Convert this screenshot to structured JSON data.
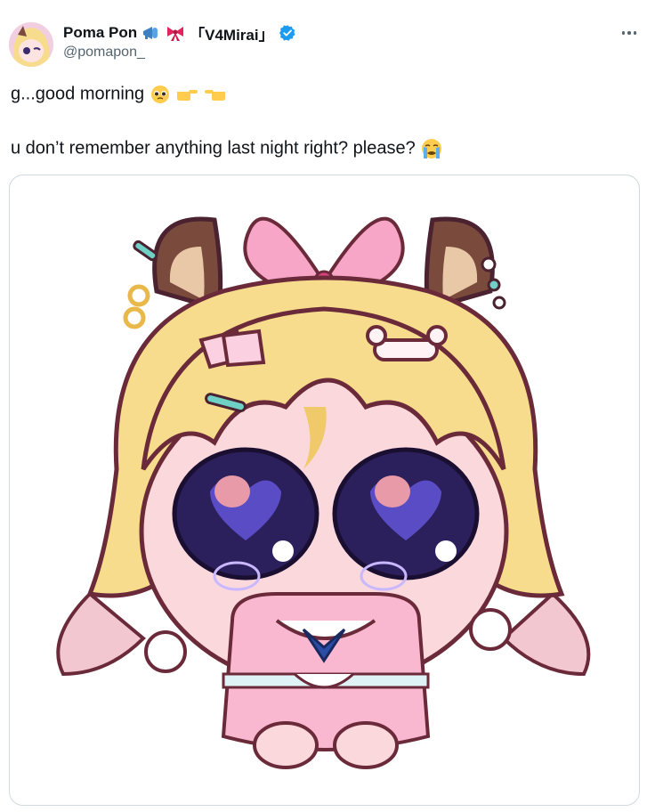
{
  "author": {
    "display_name": "Poma Pon",
    "display_name_suffix": "「V4Mirai」",
    "handle": "@pomapon_",
    "verified": true,
    "avatar_icon": "avatar-icon",
    "name_emojis": [
      "megaphone-icon",
      "ribbon-icon"
    ]
  },
  "menu": {
    "icon": "more-icon"
  },
  "tweet": {
    "line1": "g...good morning",
    "line1_emojis": [
      "pleading-face-icon",
      "point-right-icon",
      "point-left-icon"
    ],
    "line2": "u don’t remember anything last night right? please?",
    "line2_emojis": [
      "crying-face-icon"
    ]
  },
  "media": {
    "type": "illustration",
    "colors": {
      "hair": "#f6dc8c",
      "outline": "#6b2a3a",
      "horn": "#7a4a3c",
      "eyes": "#2b1f5c",
      "ribbon": "#f8a6c8",
      "skin": "#fbd8dc"
    }
  },
  "colors": {
    "text": "#0f1419",
    "secondary": "#536471",
    "verified": "#1d9bf0",
    "border": "#cfd9de"
  }
}
